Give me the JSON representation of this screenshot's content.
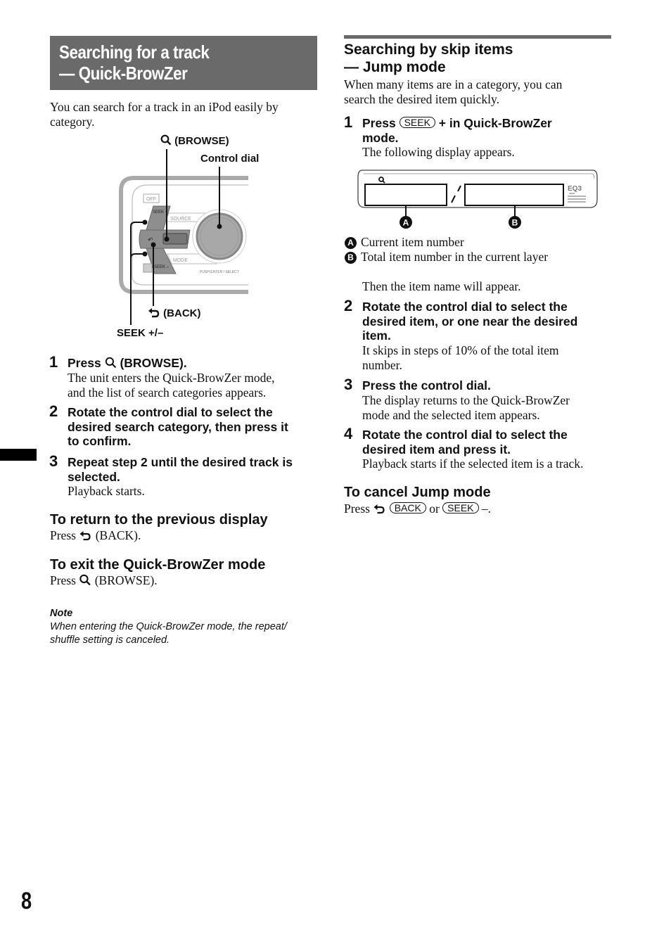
{
  "page_number": "8",
  "left_column": {
    "title_line1": "Searching for a track",
    "title_line2": "— Quick-BrowZer",
    "intro_line1": "You can search for a track in an iPod easily by",
    "intro_line2": "category.",
    "figure": {
      "browse_label": "(BROWSE)",
      "control_dial_label": "Control dial",
      "back_label": "(BACK)",
      "seek_label": "SEEK +/–",
      "unit_buttons": {
        "off": "OFF",
        "seek_plus": "SEEK +",
        "source": "SOURCE",
        "mode": "MODE",
        "seek_minus": "SEEK –",
        "push_enter": "PUSH ENTER / SELECT"
      }
    },
    "steps": [
      {
        "number": "1",
        "head_pre": "Press",
        "head_post": "(BROWSE).",
        "body_line1": "The unit enters the Quick-BrowZer mode,",
        "body_line2": "and the list of search categories appears."
      },
      {
        "number": "2",
        "head_line1": "Rotate the control dial to select the",
        "head_line2": "desired search category, then press it",
        "head_line3": "to confirm."
      },
      {
        "number": "3",
        "head_line1": "Repeat step 2 until the desired track is",
        "head_line2": "selected.",
        "body_line1": "Playback starts."
      }
    ],
    "return_section": {
      "heading": "To return to the previous display",
      "press": "Press",
      "action": "(BACK)."
    },
    "exit_section": {
      "heading": "To exit the Quick-BrowZer mode",
      "press": "Press",
      "action": "(BROWSE)."
    },
    "note": {
      "label": "Note",
      "line1": "When entering the Quick-BrowZer mode, the repeat/",
      "line2": "shuffle setting is canceled."
    }
  },
  "right_column": {
    "heading_line1": "Searching by skip items",
    "heading_line2": "— Jump mode",
    "intro_line1": "When many items are in a category, you can",
    "intro_line2": "search the desired item quickly.",
    "steps": [
      {
        "number": "1",
        "head_pre": "Press",
        "key": "SEEK",
        "head_post": "+ in Quick-BrowZer",
        "head_line2": "mode.",
        "body_line1": "The following display appears."
      },
      {
        "number": "2",
        "head_line1": "Rotate the control dial to select the",
        "head_line2": "desired item, or one near the desired",
        "head_line3": "item.",
        "body_line1": "It skips in steps of 10% of the total item",
        "body_line2": "number."
      },
      {
        "number": "3",
        "head_line1": "Press the control dial.",
        "body_line1": "The display returns to the Quick-BrowZer",
        "body_line2": "mode and the selected item appears."
      },
      {
        "number": "4",
        "head_line1": "Rotate the control dial to select the",
        "head_line2": "desired item and press it.",
        "body_line1": "Playback starts if the selected item is a track."
      }
    ],
    "display_figure": {
      "callout_a": "A",
      "callout_b": "B",
      "eq_label": "EQ3"
    },
    "legend": [
      {
        "marker": "A",
        "text": "Current item number"
      },
      {
        "marker": "B",
        "text": "Total item number in the current layer"
      }
    ],
    "after_legend": "Then the item name will appear.",
    "cancel_section": {
      "heading": "To cancel Jump mode",
      "press": "Press",
      "key_back": "BACK",
      "or": "or",
      "key_seek": "SEEK",
      "suffix": "–."
    }
  }
}
